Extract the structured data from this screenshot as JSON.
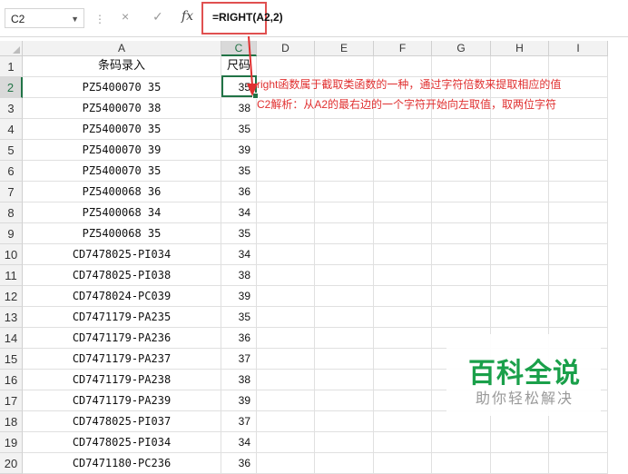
{
  "formula_bar": {
    "name_box": "C2",
    "separator": "⋮",
    "cancel_icon": "×",
    "enter_icon": "✓",
    "fx_label": "fx",
    "formula": "=RIGHT(A2,2)"
  },
  "columns": [
    "A",
    "C",
    "D",
    "E",
    "F",
    "G",
    "H",
    "I"
  ],
  "header_row": {
    "a": "条码录入",
    "c": "尺码"
  },
  "rows": [
    {
      "num": "1"
    },
    {
      "num": "2",
      "a": "PZ5400070 35",
      "c": "35"
    },
    {
      "num": "3",
      "a": "PZ5400070 38",
      "c": "38"
    },
    {
      "num": "4",
      "a": "PZ5400070 35",
      "c": "35"
    },
    {
      "num": "5",
      "a": "PZ5400070 39",
      "c": "39"
    },
    {
      "num": "6",
      "a": "PZ5400070 35",
      "c": "35"
    },
    {
      "num": "7",
      "a": "PZ5400068 36",
      "c": "36"
    },
    {
      "num": "8",
      "a": "PZ5400068 34",
      "c": "34"
    },
    {
      "num": "9",
      "a": "PZ5400068 35",
      "c": "35"
    },
    {
      "num": "10",
      "a": "CD7478025-PI034",
      "c": "34"
    },
    {
      "num": "11",
      "a": "CD7478025-PI038",
      "c": "38"
    },
    {
      "num": "12",
      "a": "CD7478024-PC039",
      "c": "39"
    },
    {
      "num": "13",
      "a": "CD7471179-PA235",
      "c": "35"
    },
    {
      "num": "14",
      "a": "CD7471179-PA236",
      "c": "36"
    },
    {
      "num": "15",
      "a": "CD7471179-PA237",
      "c": "37"
    },
    {
      "num": "16",
      "a": "CD7471179-PA238",
      "c": "38"
    },
    {
      "num": "17",
      "a": "CD7471179-PA239",
      "c": "39"
    },
    {
      "num": "18",
      "a": "CD7478025-PI037",
      "c": "37"
    },
    {
      "num": "19",
      "a": "CD7478025-PI034",
      "c": "34"
    },
    {
      "num": "20",
      "a": "CD7471180-PC236",
      "c": "36"
    }
  ],
  "annotations": {
    "line1": "right函数属于截取类函数的一种，通过字符倍数来提取相应的值",
    "line2": "C2解析：从A2的最右边的一个字符开始向左取值，取两位字符"
  },
  "watermark": {
    "title": "百科全说",
    "subtitle": "助你轻松解决"
  },
  "colors": {
    "accent": "#217346",
    "annotation": "#e03030",
    "watermark": "#1aa04a"
  }
}
